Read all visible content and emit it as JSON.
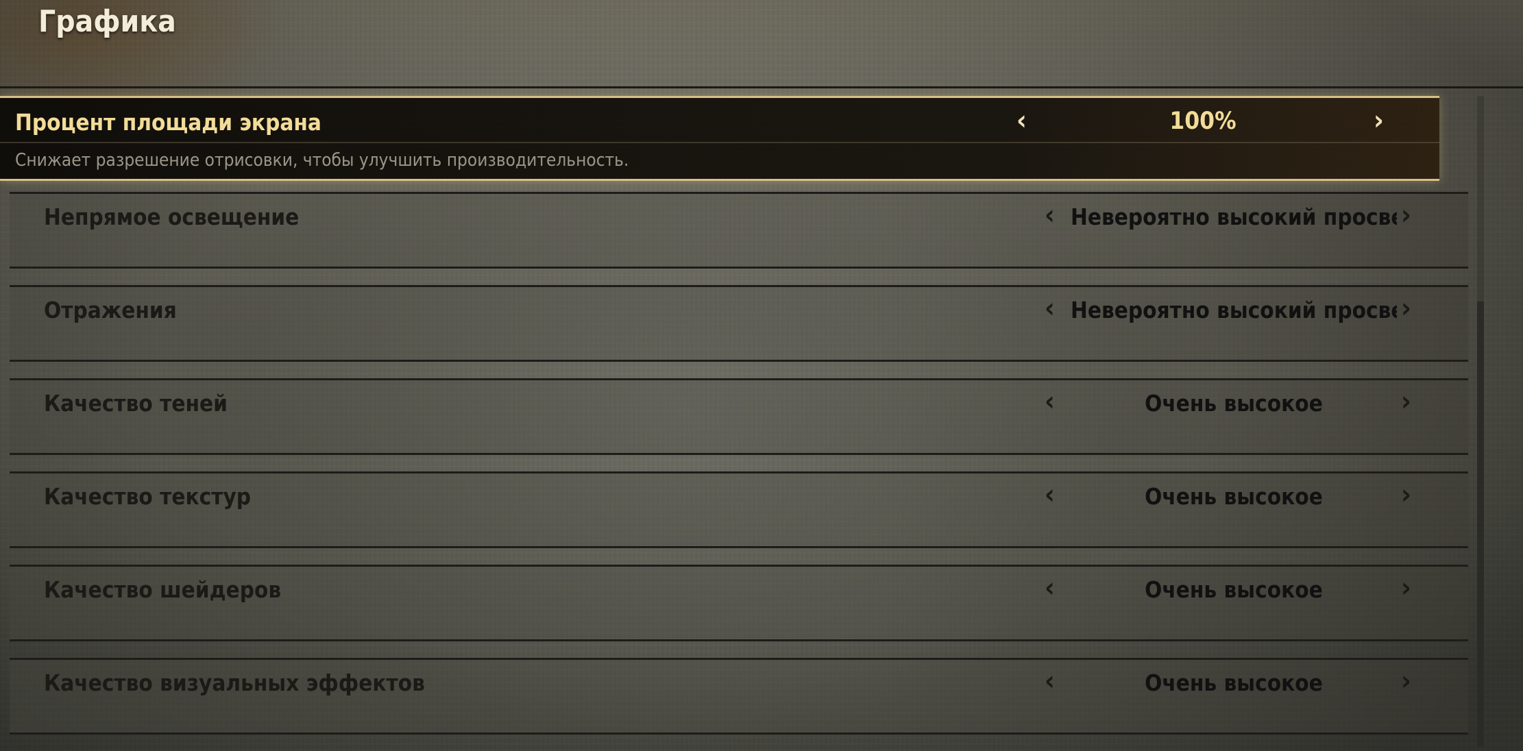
{
  "page": {
    "title": "Графика"
  },
  "selected_setting": {
    "label": "Процент площади экрана",
    "value": "100%",
    "description": "Снижает разрешение отрисовки, чтобы улучшить производительность.",
    "prev_label": "‹",
    "next_label": "›"
  },
  "settings": [
    {
      "label": "Непрямое освещение",
      "value": "Невероятно высокий просвет пот",
      "prev_label": "‹",
      "next_label": "›"
    },
    {
      "label": "Отражения",
      "value": "Невероятно высокий просвет пот",
      "prev_label": "‹",
      "next_label": "›"
    },
    {
      "label": "Качество теней",
      "value": "Очень высокое",
      "prev_label": "‹",
      "next_label": "›"
    },
    {
      "label": "Качество текстур",
      "value": "Очень высокое",
      "prev_label": "‹",
      "next_label": "›"
    },
    {
      "label": "Качество шейдеров",
      "value": "Очень высокое",
      "prev_label": "‹",
      "next_label": "›"
    },
    {
      "label": "Качество визуальных эффектов",
      "value": "Очень высокое",
      "prev_label": "‹",
      "next_label": "›"
    }
  ],
  "colors": {
    "accent_gold": "#f2dc98",
    "selected_border": "#d8c088",
    "row_text": "#1b1a17"
  }
}
